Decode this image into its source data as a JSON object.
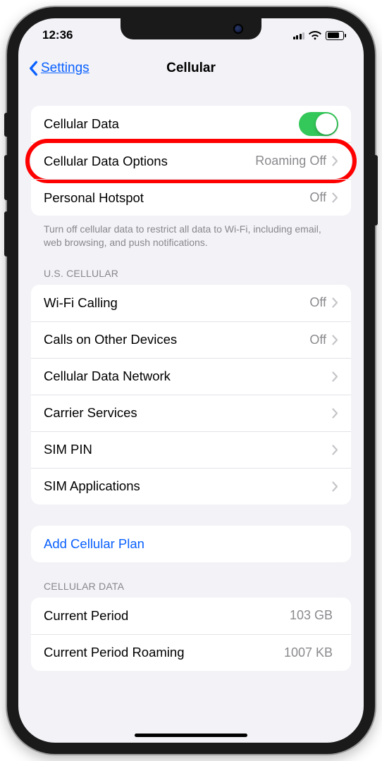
{
  "status": {
    "time": "12:36"
  },
  "nav": {
    "back": "Settings",
    "title": "Cellular"
  },
  "group1": {
    "cellular_data": "Cellular Data",
    "cellular_data_options": "Cellular Data Options",
    "cellular_data_options_value": "Roaming Off",
    "personal_hotspot": "Personal Hotspot",
    "personal_hotspot_value": "Off"
  },
  "note1": "Turn off cellular data to restrict all data to Wi-Fi, including email, web browsing, and push notifications.",
  "carrier_header": "U.S. CELLULAR",
  "carrier": {
    "wifi_calling": "Wi-Fi Calling",
    "wifi_calling_value": "Off",
    "calls_other": "Calls on Other Devices",
    "calls_other_value": "Off",
    "data_network": "Cellular Data Network",
    "carrier_services": "Carrier Services",
    "sim_pin": "SIM PIN",
    "sim_apps": "SIM Applications"
  },
  "add_plan": "Add Cellular Plan",
  "usage_header": "CELLULAR DATA",
  "usage": {
    "current_period": "Current Period",
    "current_period_value": "103 GB",
    "roaming": "Current Period Roaming",
    "roaming_value": "1007 KB"
  },
  "toggle": {
    "cellular_data_on": true
  },
  "colors": {
    "accent": "#0a60ff",
    "toggle_on": "#34c759",
    "highlight": "#ff0000"
  }
}
